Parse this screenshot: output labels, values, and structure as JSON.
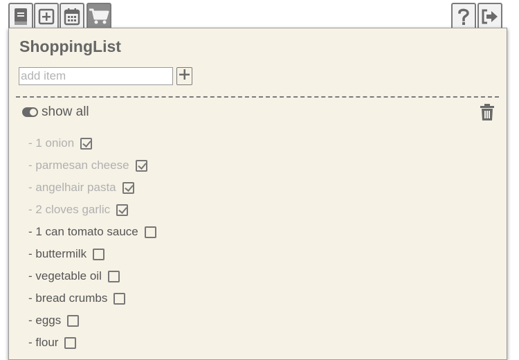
{
  "toolbar": {
    "left": [
      {
        "name": "book-icon",
        "active": false
      },
      {
        "name": "plus-square-icon",
        "active": false
      },
      {
        "name": "calendar-icon",
        "active": false
      },
      {
        "name": "shopping-cart-icon",
        "active": true
      }
    ],
    "right": [
      {
        "name": "help-icon"
      },
      {
        "name": "sign-out-icon"
      }
    ]
  },
  "panel": {
    "title": "ShoppingList",
    "add_placeholder": "add item",
    "add_button_icon": "plus-icon",
    "show_all_label": "show all",
    "show_all_toggle": "on",
    "trash_icon": "trash-icon"
  },
  "items": [
    {
      "label": "- 1 onion",
      "checked": true
    },
    {
      "label": "- parmesan cheese",
      "checked": true
    },
    {
      "label": "- angelhair pasta",
      "checked": true
    },
    {
      "label": "- 2 cloves garlic",
      "checked": true
    },
    {
      "label": "- 1 can tomato sauce",
      "checked": false
    },
    {
      "label": "- buttermilk",
      "checked": false
    },
    {
      "label": "- vegetable oil",
      "checked": false
    },
    {
      "label": "- bread crumbs",
      "checked": false
    },
    {
      "label": "- eggs",
      "checked": false
    },
    {
      "label": "- flour",
      "checked": false
    }
  ],
  "colors": {
    "panel_bg": "#f6f2e6",
    "active_tab": "#8c8c8c",
    "done_text": "#b0b0b0",
    "text": "#555555"
  }
}
